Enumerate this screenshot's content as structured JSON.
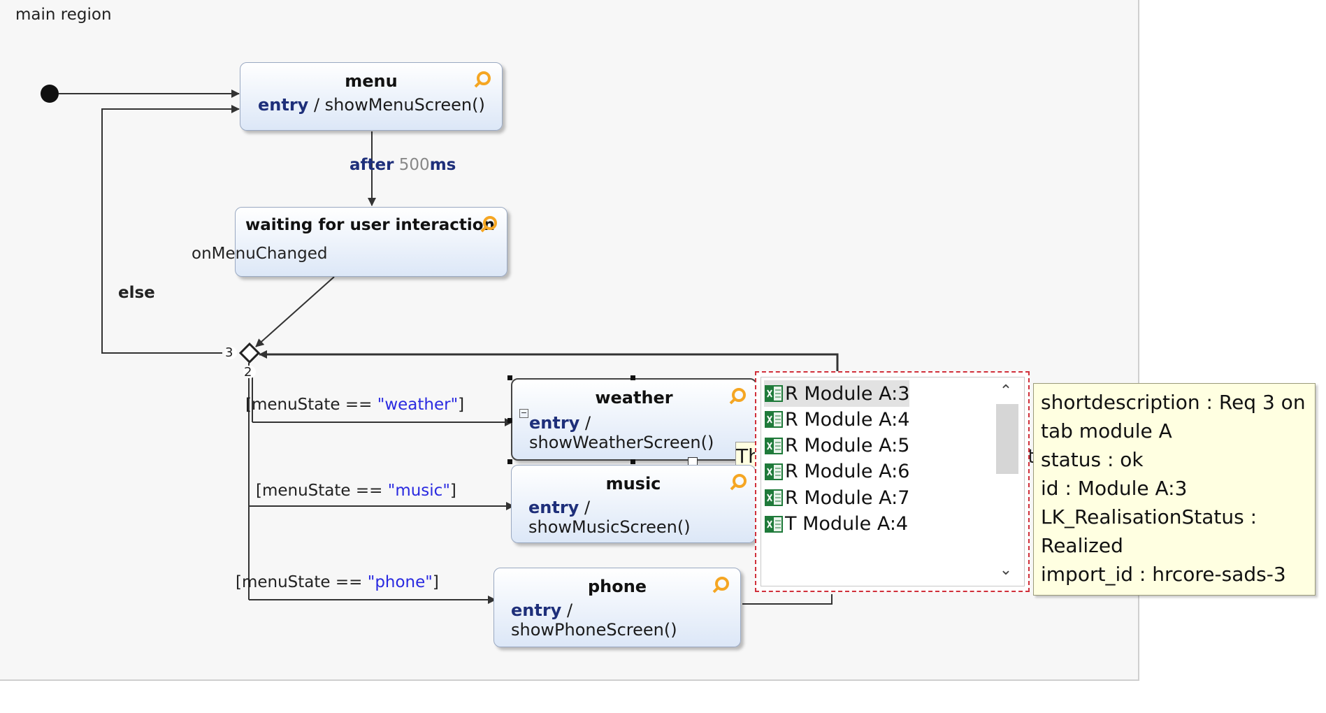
{
  "region": {
    "title": "main region"
  },
  "states": {
    "menu": {
      "name": "menu",
      "entry_kw": "entry",
      "action": " / showMenuScreen()"
    },
    "waiting": {
      "name": "waiting for user interaction",
      "sub": "onMenuChanged"
    },
    "weather": {
      "name": "weather",
      "entry_kw": "entry",
      "slash": " /",
      "action": "showWeatherScreen()"
    },
    "music": {
      "name": "music",
      "entry_kw": "entry",
      "slash": " /",
      "action": "showMusicScreen()"
    },
    "phone": {
      "name": "phone",
      "entry_kw": "entry",
      "slash": " /",
      "action": "showPhoneScreen()"
    }
  },
  "transitions": {
    "after_kw": "after",
    "after_num": "500",
    "after_unit": "ms",
    "else": "else",
    "choice_top": "3",
    "choice_bottom": "2",
    "weather_guard_pre": "[menuState == ",
    "weather_guard_str": "\"weather\"",
    "weather_guard_post": "]",
    "music_guard_pre": "[menuState == ",
    "music_guard_str": "\"music\"",
    "music_guard_post": "]",
    "phone_guard_pre": "[menuState == ",
    "phone_guard_str": "\"phone\"",
    "phone_guard_post": "]",
    "partial_event": "onMenuChanged"
  },
  "fragments": {
    "th": "Th",
    "t": "t"
  },
  "popup": {
    "items": [
      {
        "label": "R Module A:3",
        "selected": true
      },
      {
        "label": "R Module A:4"
      },
      {
        "label": "R Module A:5"
      },
      {
        "label": "R Module A:6"
      },
      {
        "label": "R Module A:7"
      },
      {
        "label": "T Module A:4"
      }
    ]
  },
  "tooltip": {
    "lines": [
      "shortdescription : Req 3 on",
      "tab module A",
      "status : ok",
      "id : Module A:3",
      "LK_RealisationStatus :",
      "Realized",
      "import_id : hrcore-sads-3"
    ]
  },
  "colors": {
    "keyword": "#1e2f7a",
    "string": "#2a2ae0",
    "ring": "#f5a623",
    "excel": "#1f7a3a"
  },
  "icons": {
    "state_marker": "ring-icon",
    "list_item": "excel-icon",
    "scroll_up": "chevron-up-icon",
    "scroll_down": "chevron-down-icon"
  }
}
